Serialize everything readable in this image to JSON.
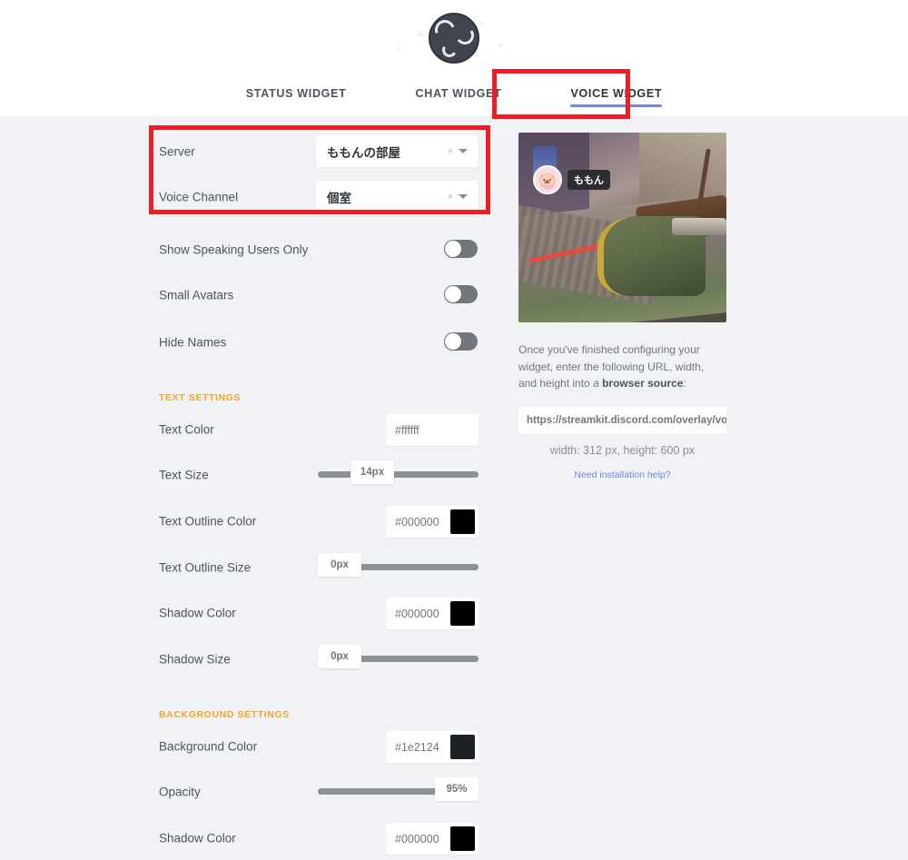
{
  "app": {
    "logo_icon": "obs-logo-icon"
  },
  "tabs": [
    {
      "label": "STATUS WIDGET",
      "active": false
    },
    {
      "label": "CHAT WIDGET",
      "active": false
    },
    {
      "label": "VOICE WIDGET",
      "active": true
    }
  ],
  "settings": {
    "server": {
      "label": "Server",
      "value": "ももんの部屋",
      "clear_icon": "×",
      "chevron_icon": "chevron-down-icon"
    },
    "voice_channel": {
      "label": "Voice Channel",
      "value": "個室",
      "clear_icon": "×",
      "chevron_icon": "chevron-down-icon"
    },
    "toggles": [
      {
        "label": "Show Speaking Users Only",
        "on": false
      },
      {
        "label": "Small Avatars",
        "on": false
      },
      {
        "label": "Hide Names",
        "on": false
      }
    ],
    "text_section": {
      "heading": "TEXT SETTINGS",
      "text_color": {
        "label": "Text Color",
        "value": "#ffffff",
        "swatch": "#ffffff"
      },
      "text_size": {
        "label": "Text Size",
        "value": "14px",
        "percent": 33
      },
      "text_outline_color": {
        "label": "Text Outline Color",
        "value": "#000000",
        "swatch": "#000000"
      },
      "text_outline_size": {
        "label": "Text Outline Size",
        "value": "0px",
        "percent": 0
      },
      "shadow_color": {
        "label": "Shadow Color",
        "value": "#000000",
        "swatch": "#000000"
      },
      "shadow_size": {
        "label": "Shadow Size",
        "value": "0px",
        "percent": 0
      }
    },
    "background_section": {
      "heading": "BACKGROUND SETTINGS",
      "background_color": {
        "label": "Background Color",
        "value": "#1e2124",
        "swatch": "#1e2124"
      },
      "opacity": {
        "label": "Opacity",
        "value": "95%",
        "percent": 95
      },
      "shadow_color": {
        "label": "Shadow Color",
        "value": "#000000",
        "swatch": "#000000"
      }
    }
  },
  "preview": {
    "username": "ももん",
    "avatar_icon": "user-avatar-bear",
    "help_line1": "Once you've finished configuring your widget,",
    "help_line2": "enter the following URL, width, and height into",
    "help_line3_pre": "a ",
    "help_line3_bold": "browser source",
    "help_line3_post": ":",
    "url": "https://streamkit.discord.com/overlay/voice",
    "dimensions": "width: 312 px, height: 600 px",
    "help_link": "Need installation help?"
  },
  "colors": {
    "accent_blue": "#7289da",
    "section_orange": "#f5a623",
    "annotation_red": "#ee1c25",
    "page_bg": "#f1f2f5"
  }
}
